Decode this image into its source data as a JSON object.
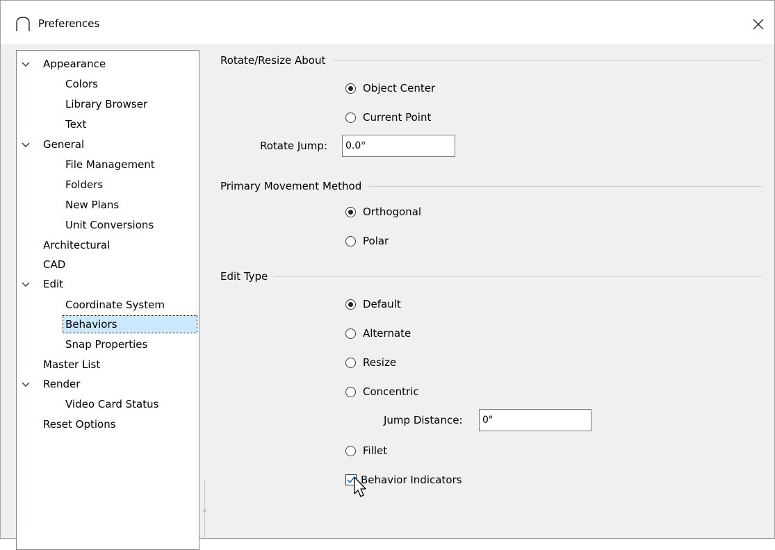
{
  "window": {
    "title": "Preferences"
  },
  "tree": {
    "items": [
      {
        "label": "Appearance",
        "level": 0,
        "expanded": true
      },
      {
        "label": "Colors",
        "level": 1
      },
      {
        "label": "Library Browser",
        "level": 1
      },
      {
        "label": "Text",
        "level": 1
      },
      {
        "label": "General",
        "level": 0,
        "expanded": true
      },
      {
        "label": "File Management",
        "level": 1
      },
      {
        "label": "Folders",
        "level": 1
      },
      {
        "label": "New Plans",
        "level": 1
      },
      {
        "label": "Unit Conversions",
        "level": 1
      },
      {
        "label": "Architectural",
        "level": 0
      },
      {
        "label": "CAD",
        "level": 0
      },
      {
        "label": "Edit",
        "level": 0,
        "expanded": true
      },
      {
        "label": "Coordinate System",
        "level": 1
      },
      {
        "label": "Behaviors",
        "level": 1,
        "selected": true
      },
      {
        "label": "Snap Properties",
        "level": 1
      },
      {
        "label": "Master List",
        "level": 0
      },
      {
        "label": "Render",
        "level": 0,
        "expanded": true
      },
      {
        "label": "Video Card Status",
        "level": 1
      },
      {
        "label": "Reset Options",
        "level": 0
      }
    ]
  },
  "rotate_resize": {
    "title": "Rotate/Resize About",
    "option_object_center": "Object Center",
    "option_current_point": "Current Point",
    "selected": "Object Center",
    "rotate_jump_label": "Rotate Jump:",
    "rotate_jump_value": "0.0°"
  },
  "movement": {
    "title": "Primary Movement Method",
    "option_orthogonal": "Orthogonal",
    "option_polar": "Polar",
    "selected": "Orthogonal"
  },
  "edit_type": {
    "title": "Edit Type",
    "option_default": "Default",
    "option_alternate": "Alternate",
    "option_resize": "Resize",
    "option_concentric": "Concentric",
    "option_fillet": "Fillet",
    "selected": "Default",
    "jump_distance_label": "Jump Distance:",
    "jump_distance_value": "0\"",
    "behavior_indicators_label": "Behavior Indicators",
    "behavior_indicators_checked": true
  },
  "colors": {
    "selection_bg": "#cce8ff",
    "dialog_bg": "#f0f0f0",
    "check_color": "#1a6fd0"
  }
}
